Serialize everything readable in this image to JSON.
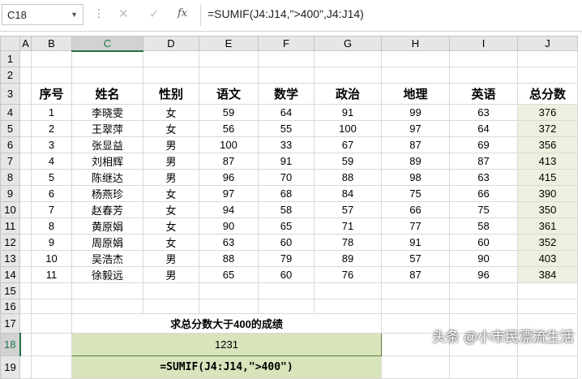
{
  "formula_bar": {
    "name_box": "C18",
    "fx_label": "fx",
    "formula": "=SUMIF(J4:J14,\">400\",J4:J14)"
  },
  "columns": [
    "A",
    "B",
    "C",
    "D",
    "E",
    "F",
    "G",
    "H",
    "I",
    "J"
  ],
  "rows": {
    "r1": "1",
    "r2": "2",
    "r3": "3",
    "r4": "4",
    "r5": "5",
    "r6": "6",
    "r7": "7",
    "r8": "8",
    "r9": "9",
    "r10": "10",
    "r11": "11",
    "r12": "12",
    "r13": "13",
    "r14": "14",
    "r15": "15",
    "r16": "16",
    "r17": "17",
    "r18": "18",
    "r19": "19"
  },
  "table": {
    "headers": [
      "序号",
      "姓名",
      "性别",
      "语文",
      "数学",
      "政治",
      "地理",
      "英语",
      "总分数"
    ],
    "records": [
      [
        "1",
        "李晓雯",
        "女",
        "59",
        "64",
        "91",
        "99",
        "63",
        "376"
      ],
      [
        "2",
        "王翠萍",
        "女",
        "56",
        "55",
        "100",
        "97",
        "64",
        "372"
      ],
      [
        "3",
        "张显益",
        "男",
        "100",
        "33",
        "67",
        "87",
        "69",
        "356"
      ],
      [
        "4",
        "刘相辉",
        "男",
        "87",
        "91",
        "59",
        "89",
        "87",
        "413"
      ],
      [
        "5",
        "陈继达",
        "男",
        "96",
        "70",
        "88",
        "98",
        "63",
        "415"
      ],
      [
        "6",
        "杨燕珍",
        "女",
        "97",
        "68",
        "84",
        "75",
        "66",
        "390"
      ],
      [
        "7",
        "赵春芳",
        "女",
        "94",
        "58",
        "57",
        "66",
        "75",
        "350"
      ],
      [
        "8",
        "黄原娟",
        "女",
        "90",
        "65",
        "71",
        "77",
        "58",
        "361"
      ],
      [
        "9",
        "周原娟",
        "女",
        "63",
        "60",
        "78",
        "91",
        "60",
        "352"
      ],
      [
        "10",
        "吴浩杰",
        "男",
        "88",
        "79",
        "89",
        "57",
        "90",
        "403"
      ],
      [
        "11",
        "徐毅远",
        "男",
        "65",
        "60",
        "76",
        "87",
        "96",
        "384"
      ]
    ]
  },
  "task": {
    "title": "求总分数大于400的成绩",
    "result": "1231",
    "formula_display": "=SUMIF(J4:J14,\">400\")"
  },
  "watermark": "头条 @小市民漂流生活"
}
